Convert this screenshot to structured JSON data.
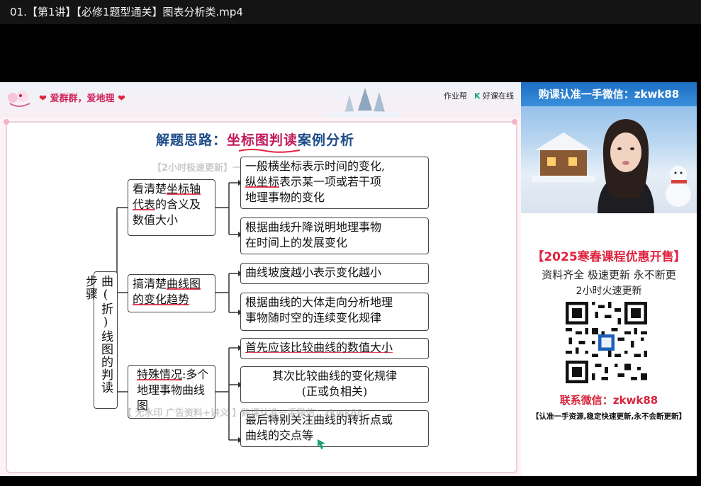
{
  "window": {
    "title": "01.【第1讲】【必修1题型通关】图表分析类.mp4"
  },
  "slide": {
    "header": {
      "slogan_left_heart": "❤",
      "slogan": "爱群群，爱地理",
      "slogan_right_heart": "❤",
      "logo_a": "作业帮",
      "logo_b_k": "K",
      "logo_b": "好课在线"
    },
    "title_prefix": "解题思路：",
    "title_highlight": "坐标图判读",
    "title_suffix": "案例分析",
    "watermark_top": "【2小时极速更新】一v",
    "watermark_bottom": "【 无水印 广告资料+讲义 】购课认准一手微信：zkwk88",
    "root": "曲(折)线图的判读步骤",
    "level1": [
      {
        "pre": "看清楚",
        "mark": "坐标轴",
        "post": "代表",
        "rest": "的含义及数值大小"
      },
      {
        "pre": "搞清楚",
        "mark": "曲线图",
        "post": "的变化趋势"
      },
      {
        "pre": "",
        "mark": "特殊情况",
        "post": ":多个地理事物曲线图"
      }
    ],
    "level2": [
      {
        "a": "一般横坐标表示时间的变化,",
        "b_mark": "纵坐标",
        "b": "表示某一项或若干项",
        "c": "地理事物的变化"
      },
      {
        "a": "根据曲线升降说明地理事物",
        "b": "在时间上的发展变化"
      },
      {
        "a": "曲线坡度越小表示变化越小"
      },
      {
        "a": "根据曲线的大体走向分析地理",
        "b": "事物随时空的连续变化规律"
      },
      {
        "a": "首先应该比较曲线的数值大小"
      },
      {
        "a": "其次比较曲线的变化规律",
        "b": "(正或负相关)"
      },
      {
        "a": "最后特别关注曲线的转折点或",
        "b": "曲线的交点等"
      }
    ]
  },
  "sidebar": {
    "banner": "购课认准一手微信：zkwk88",
    "promo_title": "【2025寒春课程优惠开售】",
    "promo_line": "资料齐全  极速更新  永不断更",
    "promo_line2": "2小时火速更新",
    "contact": "联系微信：zkwk88",
    "contact_note": "【认准一手资源,稳定快速更新,永不会断更新】"
  },
  "colors": {
    "accent_red": "#e0243f",
    "title_blue": "#1d4b88",
    "highlight_pink": "#c2185b"
  }
}
